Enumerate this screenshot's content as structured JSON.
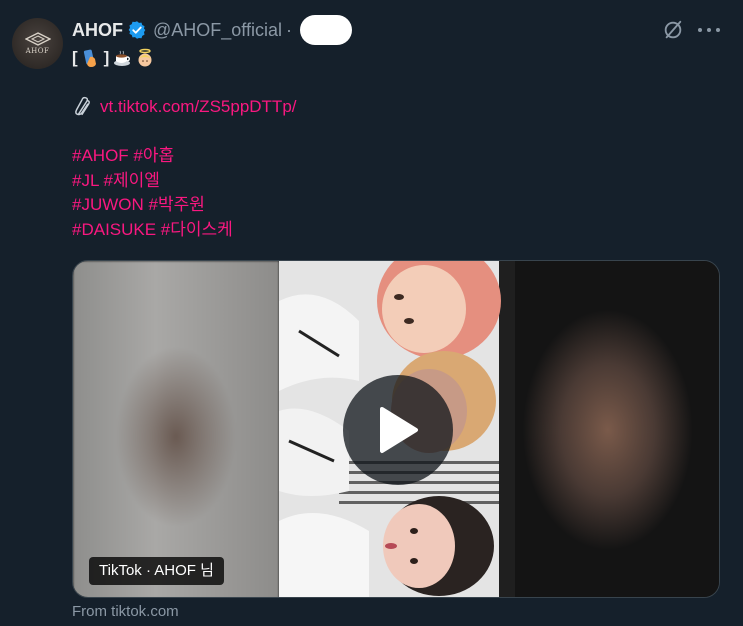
{
  "author": {
    "display_name": "AHOF",
    "handle": "@AHOF_official",
    "separator": "·",
    "avatar_text": "AHOF",
    "verified": true
  },
  "tweet": {
    "emoji_line_open": "[",
    "emoji_line_close": "]",
    "emojis": [
      "selfie-hand-emoji",
      "coffee-emoji",
      "angel-emoji"
    ],
    "link": "vt.tiktok.com/ZS5ppDTTp/",
    "hashtags": [
      "#AHOF #아홉",
      "#JL #제이엘",
      "#JUWON #박주원",
      "#DAISUKE #다이스케"
    ]
  },
  "media": {
    "label": "TikTok · AHOF 님",
    "source": "From tiktok.com"
  },
  "colors": {
    "background": "#15202b",
    "hashtag": "#f91880",
    "verified": "#1d9bf0",
    "muted": "#8b98a5"
  }
}
